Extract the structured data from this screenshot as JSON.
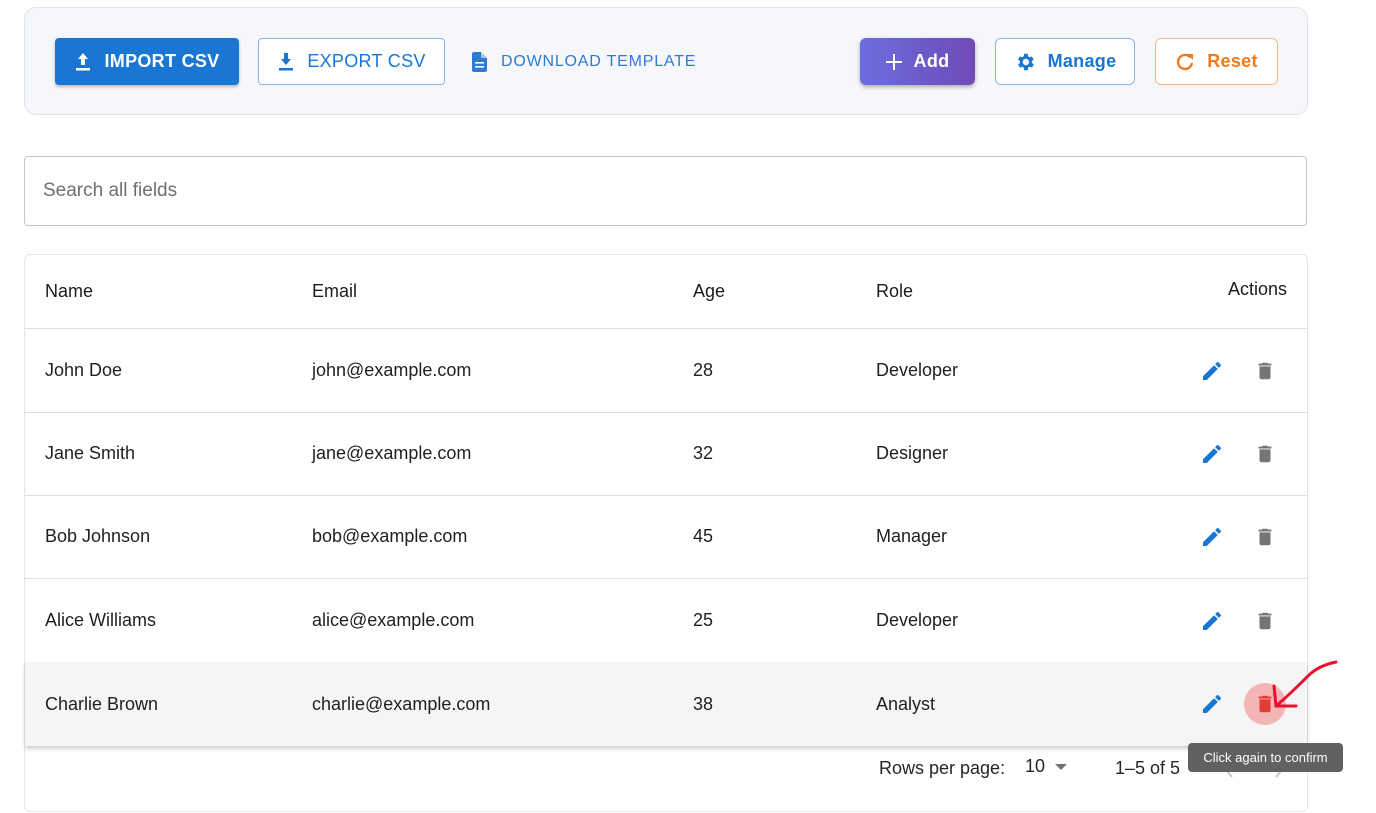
{
  "toolbar": {
    "import_label": "IMPORT CSV",
    "export_label": "EXPORT CSV",
    "template_label": "DOWNLOAD TEMPLATE",
    "add_label": "Add",
    "manage_label": "Manage",
    "reset_label": "Reset"
  },
  "search": {
    "placeholder": "Search all fields",
    "value": ""
  },
  "table": {
    "columns": {
      "name": "Name",
      "email": "Email",
      "age": "Age",
      "role": "Role",
      "actions": "Actions"
    },
    "rows": [
      {
        "name": "John Doe",
        "email": "john@example.com",
        "age": "28",
        "role": "Developer"
      },
      {
        "name": "Jane Smith",
        "email": "jane@example.com",
        "age": "32",
        "role": "Designer"
      },
      {
        "name": "Bob Johnson",
        "email": "bob@example.com",
        "age": "45",
        "role": "Manager"
      },
      {
        "name": "Alice Williams",
        "email": "alice@example.com",
        "age": "25",
        "role": "Developer"
      },
      {
        "name": "Charlie Brown",
        "email": "charlie@example.com",
        "age": "38",
        "role": "Analyst"
      }
    ],
    "row_actions": {
      "edit_icon": "pencil-icon",
      "delete_icon": "trash-icon"
    }
  },
  "pagination": {
    "rows_per_page_label": "Rows per page:",
    "rows_per_page_value": "10",
    "range_text": "1–5 of 5"
  },
  "tooltip": {
    "text": "Click again to confirm"
  },
  "colors": {
    "primary": "#1976d2",
    "add_gradient_start": "#6b6ee0",
    "add_gradient_end": "#6f4ab7",
    "reset_orange": "#ef7a1a",
    "delete_armed_red": "#e53935",
    "delete_idle_gray": "#757575",
    "annotation_red": "#e8112d"
  }
}
